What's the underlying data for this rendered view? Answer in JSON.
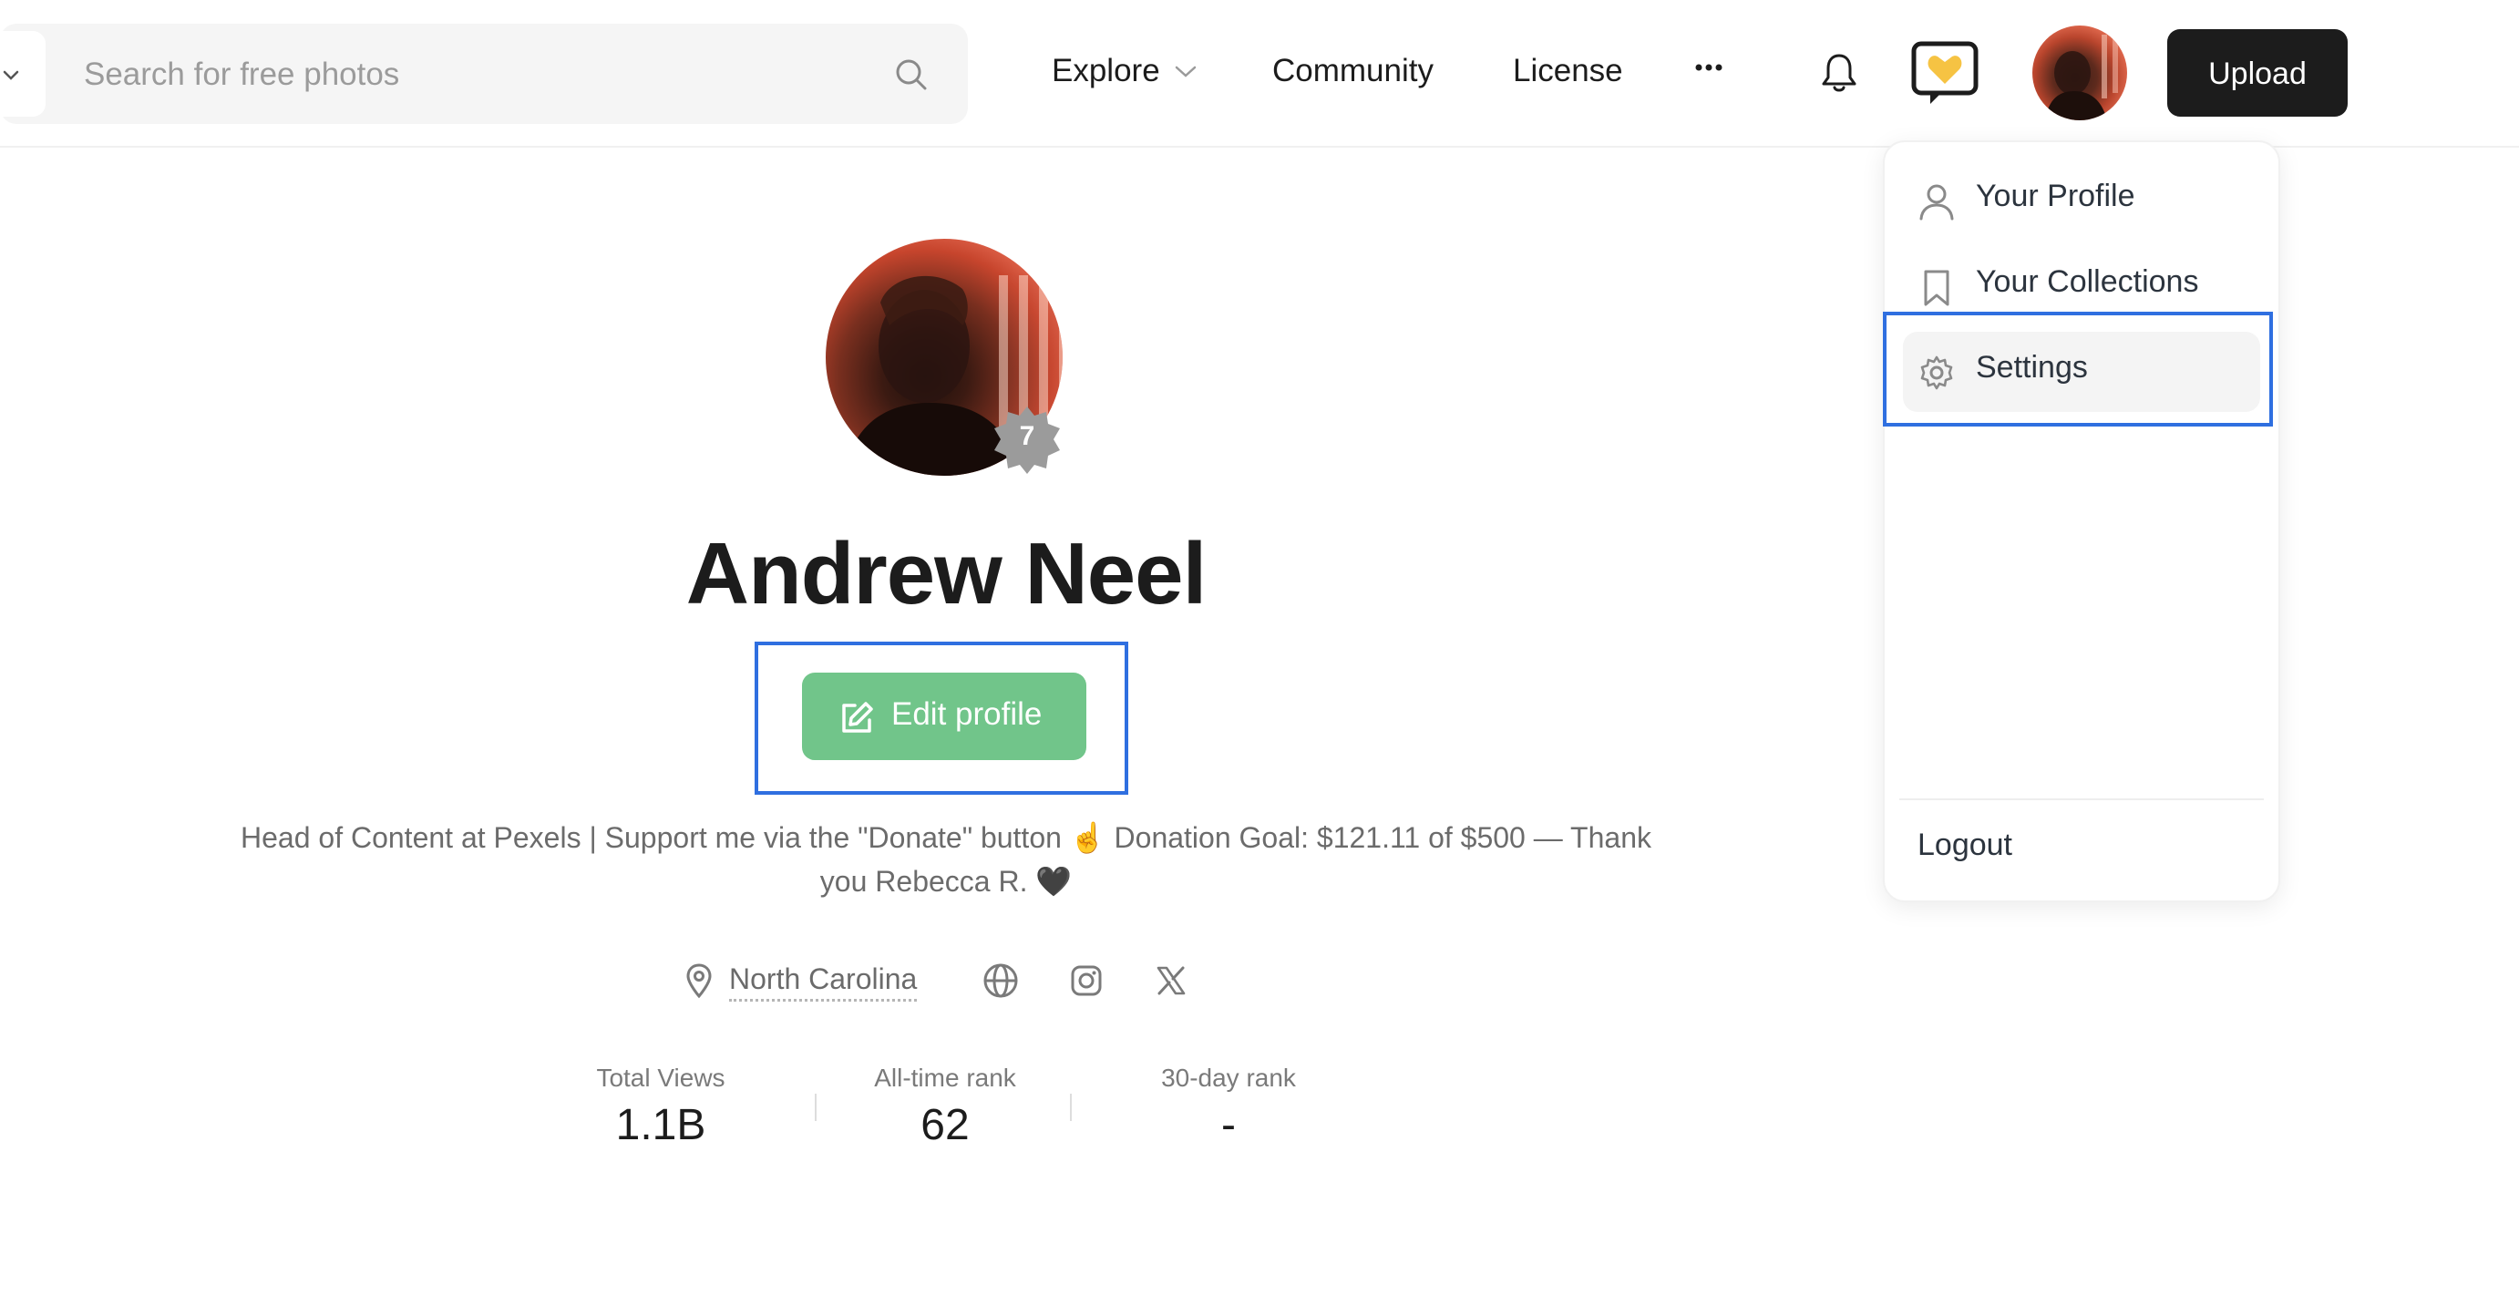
{
  "header": {
    "search": {
      "placeholder": "Search for free photos"
    },
    "nav": {
      "explore": "Explore",
      "community": "Community",
      "license": "License",
      "more": "···"
    },
    "upload_label": "Upload"
  },
  "dropdown": {
    "items": [
      {
        "label": "Your Profile",
        "icon": "user-icon"
      },
      {
        "label": "Your Collections",
        "icon": "bookmark-icon"
      },
      {
        "label": "Settings",
        "icon": "gear-icon"
      }
    ],
    "logout_label": "Logout"
  },
  "profile": {
    "level": "7",
    "name": "Andrew Neel",
    "edit_label": "Edit profile",
    "bio": "Head of Content at Pexels | Support me via the \"Donate\" button ☝️ Donation Goal: $121.11 of $500 — Thank you Rebecca R. 🖤",
    "location": "North Carolina",
    "stats": [
      {
        "label": "Total Views",
        "value": "1.1B"
      },
      {
        "label": "All-time rank",
        "value": "62"
      },
      {
        "label": "30-day rank",
        "value": "-"
      }
    ]
  },
  "colors": {
    "accent_green": "#71c58a",
    "highlight_blue": "#2f6fe0",
    "upload_bg": "#1c1c1c",
    "heart_yellow": "#f6c343"
  }
}
